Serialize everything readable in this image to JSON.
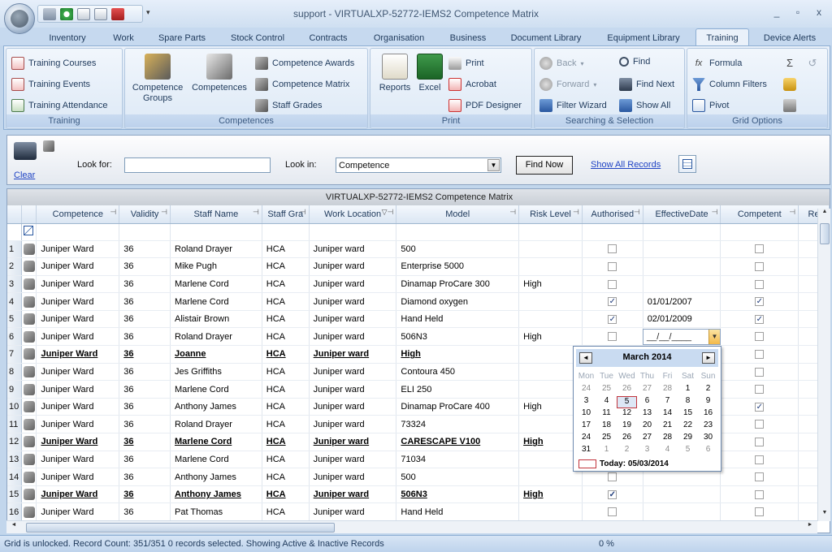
{
  "window": {
    "title": "support - VIRTUALXP-52772-IEMS2 Competence Matrix",
    "controls": [
      "_",
      "▫",
      "x"
    ]
  },
  "tabs": [
    "Inventory",
    "Work",
    "Spare Parts",
    "Stock Control",
    "Contracts",
    "Organisation",
    "Business",
    "Document Library",
    "Equipment Library",
    "Training",
    "Device Alerts"
  ],
  "active_tab": "Training",
  "ribbon": {
    "training": {
      "title": "Training",
      "items": [
        "Training Courses",
        "Training Events",
        "Training Attendance"
      ]
    },
    "competences": {
      "title": "Competences",
      "big": [
        "Competence Groups",
        "Competences"
      ],
      "small": [
        "Competence Awards",
        "Competence Matrix",
        "Staff Grades"
      ]
    },
    "print": {
      "title": "Print",
      "big": [
        "Reports",
        "Excel"
      ],
      "small": [
        "Print",
        "Acrobat",
        "PDF Designer"
      ]
    },
    "searching": {
      "title": "Searching & Selection",
      "items": [
        "Back",
        "Forward",
        "Filter Wizard",
        "Find",
        "Find Next",
        "Show All"
      ]
    },
    "grid_options": {
      "title": "Grid Options",
      "items": [
        "Formula",
        "Column Filters",
        "Pivot"
      ]
    }
  },
  "search": {
    "clear_label": "Clear",
    "lookfor_label": "Look for:",
    "lookfor_value": "",
    "lookin_label": "Look in:",
    "lookin_value": "Competence",
    "find_now": "Find Now",
    "show_all": "Show All Records"
  },
  "grid": {
    "caption": "VIRTUALXP-52772-IEMS2 Competence Matrix",
    "columns": [
      "Competence",
      "Validity",
      "Staff Name",
      "Staff Gra",
      "Work Location",
      "Model",
      "Risk Level",
      "Authorised",
      "EffectiveDate",
      "Competent",
      "Re"
    ],
    "rows": [
      {
        "n": "1",
        "competence": "Juniper Ward",
        "validity": "36",
        "staff": "Roland Drayer",
        "grade": "HCA",
        "location": "Juniper ward",
        "model": "500",
        "risk": "",
        "authorised": false,
        "date": "",
        "competent": false,
        "alert": false
      },
      {
        "n": "2",
        "competence": "Juniper Ward",
        "validity": "36",
        "staff": "Mike Pugh",
        "grade": "HCA",
        "location": "Juniper ward",
        "model": "Enterprise 5000",
        "risk": "",
        "authorised": false,
        "date": "",
        "competent": false,
        "alert": false
      },
      {
        "n": "3",
        "competence": "Juniper Ward",
        "validity": "36",
        "staff": "Marlene Cord",
        "grade": "HCA",
        "location": "Juniper ward",
        "model": "Dinamap ProCare 300",
        "risk": "High",
        "authorised": false,
        "date": "",
        "competent": false,
        "alert": false
      },
      {
        "n": "4",
        "competence": "Juniper Ward",
        "validity": "36",
        "staff": "Marlene Cord",
        "grade": "HCA",
        "location": "Juniper ward",
        "model": "Diamond oxygen",
        "risk": "",
        "authorised": true,
        "date": "01/01/2007",
        "competent": true,
        "alert": false
      },
      {
        "n": "5",
        "competence": "Juniper Ward",
        "validity": "36",
        "staff": "Alistair Brown",
        "grade": "HCA",
        "location": "Juniper ward",
        "model": "Hand Held",
        "risk": "",
        "authorised": true,
        "date": "02/01/2009",
        "competent": true,
        "alert": false
      },
      {
        "n": "6",
        "competence": "Juniper Ward",
        "validity": "36",
        "staff": "Roland Drayer",
        "grade": "HCA",
        "location": "Juniper ward",
        "model": "506N3",
        "risk": "High",
        "authorised": false,
        "date": "",
        "competent": false,
        "alert": false
      },
      {
        "n": "7",
        "competence": "Juniper Ward",
        "validity": "36",
        "staff": "Joanne",
        "grade": "HCA",
        "location": "Juniper ward",
        "model": "High",
        "risk": "",
        "authorised": false,
        "date": "",
        "competent": false,
        "alert": true
      },
      {
        "n": "8",
        "competence": "Juniper Ward",
        "validity": "36",
        "staff": "Jes Griffiths",
        "grade": "HCA",
        "location": "Juniper ward",
        "model": "Contoura 450",
        "risk": "",
        "authorised": false,
        "date": "",
        "competent": false,
        "alert": false
      },
      {
        "n": "9",
        "competence": "Juniper Ward",
        "validity": "36",
        "staff": "Marlene Cord",
        "grade": "HCA",
        "location": "Juniper ward",
        "model": "ELI 250",
        "risk": "",
        "authorised": false,
        "date": "",
        "competent": false,
        "alert": false
      },
      {
        "n": "10",
        "competence": "Juniper Ward",
        "validity": "36",
        "staff": "Anthony James",
        "grade": "HCA",
        "location": "Juniper ward",
        "model": "Dinamap ProCare 400",
        "risk": "High",
        "authorised": false,
        "date": "",
        "competent": true,
        "alert": false
      },
      {
        "n": "11",
        "competence": "Juniper Ward",
        "validity": "36",
        "staff": "Roland Drayer",
        "grade": "HCA",
        "location": "Juniper ward",
        "model": "73324",
        "risk": "",
        "authorised": false,
        "date": "",
        "competent": false,
        "alert": false
      },
      {
        "n": "12",
        "competence": "Juniper Ward",
        "validity": "36",
        "staff": "Marlene Cord",
        "grade": "HCA",
        "location": "Juniper ward",
        "model": "CARESCAPE V100",
        "risk": "High",
        "authorised": false,
        "date": "",
        "competent": false,
        "alert": true
      },
      {
        "n": "13",
        "competence": "Juniper Ward",
        "validity": "36",
        "staff": "Marlene Cord",
        "grade": "HCA",
        "location": "Juniper ward",
        "model": "71034",
        "risk": "",
        "authorised": false,
        "date": "",
        "competent": false,
        "alert": false
      },
      {
        "n": "14",
        "competence": "Juniper Ward",
        "validity": "36",
        "staff": "Anthony James",
        "grade": "HCA",
        "location": "Juniper ward",
        "model": "500",
        "risk": "",
        "authorised": false,
        "date": "",
        "competent": false,
        "alert": false
      },
      {
        "n": "15",
        "competence": "Juniper Ward",
        "validity": "36",
        "staff": "Anthony James",
        "grade": "HCA",
        "location": "Juniper ward",
        "model": "506N3",
        "risk": "High",
        "authorised": true,
        "date": "",
        "competent": false,
        "alert": true
      },
      {
        "n": "16",
        "competence": "Juniper Ward",
        "validity": "36",
        "staff": "Pat Thomas",
        "grade": "HCA",
        "location": "Juniper ward",
        "model": "Hand Held",
        "risk": "",
        "authorised": false,
        "date": "",
        "competent": false,
        "alert": false
      }
    ]
  },
  "date_editor": {
    "value": "__/__/____"
  },
  "calendar": {
    "title": "March 2014",
    "prev": "◄",
    "next": "►",
    "dow": [
      "Mon",
      "Tue",
      "Wed",
      "Thu",
      "Fri",
      "Sat",
      "Sun"
    ],
    "weeks": [
      [
        [
          "24",
          true
        ],
        [
          "25",
          true
        ],
        [
          "26",
          true
        ],
        [
          "27",
          true
        ],
        [
          "28",
          true
        ],
        [
          "1",
          false
        ],
        [
          "2",
          false
        ]
      ],
      [
        [
          "3",
          false
        ],
        [
          "4",
          false
        ],
        [
          "5",
          false
        ],
        [
          "6",
          false
        ],
        [
          "7",
          false
        ],
        [
          "8",
          false
        ],
        [
          "9",
          false
        ]
      ],
      [
        [
          "10",
          false
        ],
        [
          "11",
          false
        ],
        [
          "12",
          false
        ],
        [
          "13",
          false
        ],
        [
          "14",
          false
        ],
        [
          "15",
          false
        ],
        [
          "16",
          false
        ]
      ],
      [
        [
          "17",
          false
        ],
        [
          "18",
          false
        ],
        [
          "19",
          false
        ],
        [
          "20",
          false
        ],
        [
          "21",
          false
        ],
        [
          "22",
          false
        ],
        [
          "23",
          false
        ]
      ],
      [
        [
          "24",
          false
        ],
        [
          "25",
          false
        ],
        [
          "26",
          false
        ],
        [
          "27",
          false
        ],
        [
          "28",
          false
        ],
        [
          "29",
          false
        ],
        [
          "30",
          false
        ]
      ],
      [
        [
          "31",
          false
        ],
        [
          "1",
          true
        ],
        [
          "2",
          true
        ],
        [
          "3",
          true
        ],
        [
          "4",
          true
        ],
        [
          "5",
          true
        ],
        [
          "6",
          true
        ]
      ]
    ],
    "selected": "5",
    "today_label": "Today: 05/03/2014"
  },
  "status": {
    "text": "Grid is unlocked.  Record Count: 351/351  0 records selected.  Showing Active & Inactive Records",
    "percent": "0 %"
  },
  "colors": {
    "alert_text": "#e2001a",
    "ribbon_bg": "#d6e4f4",
    "accent": "#1e395b"
  }
}
